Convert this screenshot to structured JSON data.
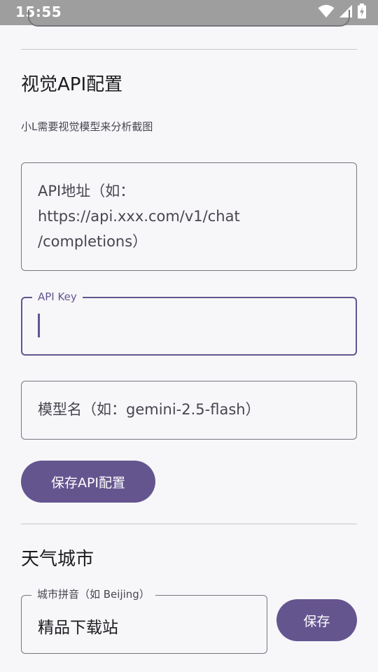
{
  "status_bar": {
    "time": "15:55"
  },
  "vision_api": {
    "title": "视觉API配置",
    "description": "小L需要视觉模型来分析截图",
    "api_url_placeholder": "API地址（如：\nhttps://api.xxx.com/v1/chat\n/completions）",
    "api_key_label": "API Key",
    "api_key_value": "",
    "model_placeholder": "模型名（如：gemini-2.5-flash）",
    "save_label": "保存API配置"
  },
  "weather": {
    "title": "天气城市",
    "city_label": "城市拼音（如 Beijing）",
    "city_value": "精品下载站",
    "save_label": "保存"
  },
  "colors": {
    "primary": "#65558f",
    "outline": "#79747e",
    "background": "#f7f7fa",
    "status_bar": "#9e9e9e"
  }
}
